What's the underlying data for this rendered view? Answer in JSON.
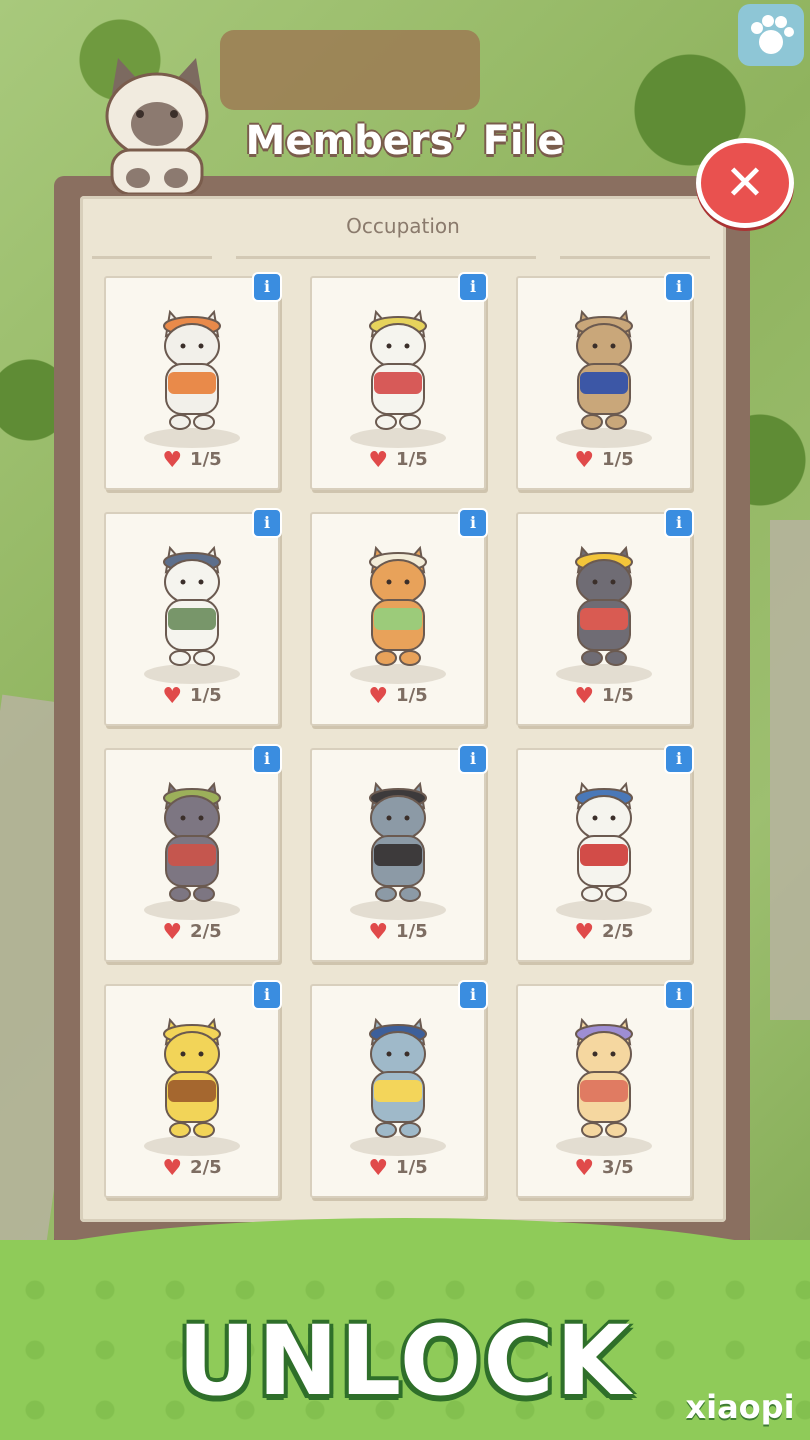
{
  "header": {
    "title": "Members’ File"
  },
  "section": {
    "label": "Occupation"
  },
  "cards": [
    {
      "count": "1/5",
      "cat": "cat-carrying-towels",
      "body": "#f2f0ea",
      "accent": "#e98a4a",
      "hat": "#e98a4a"
    },
    {
      "count": "1/5",
      "cat": "cat-gardener-watering-can",
      "body": "#f5f4ee",
      "accent": "#d75a58",
      "hat": "#e6d35c"
    },
    {
      "count": "1/5",
      "cat": "cat-basketball-player",
      "body": "#c9a77a",
      "accent": "#3c57a6",
      "hat": "#c9a77a"
    },
    {
      "count": "1/5",
      "cat": "cat-painter-palette",
      "body": "#f5f4ee",
      "accent": "#78966a",
      "hat": "#5d6f8c"
    },
    {
      "count": "1/5",
      "cat": "cat-fisher-with-bucket",
      "body": "#e8a25a",
      "accent": "#9ccb7a",
      "hat": "#f3ecd8"
    },
    {
      "count": "1/5",
      "cat": "cat-construction-worker",
      "body": "#6f6c74",
      "accent": "#d95b52",
      "hat": "#f2c53a"
    },
    {
      "count": "2/5",
      "cat": "cat-roman-orator",
      "body": "#7d7682",
      "accent": "#c5564e",
      "hat": "#9cb05a"
    },
    {
      "count": "1/5",
      "cat": "cat-gentleman-suit",
      "body": "#8c9aa6",
      "accent": "#3d3a3b",
      "hat": "#3d3a3b"
    },
    {
      "count": "2/5",
      "cat": "cat-rapper-striped-shirt",
      "body": "#f5f4ee",
      "accent": "#d24c48",
      "hat": "#4a78b8"
    },
    {
      "count": "2/5",
      "cat": "cat-bee-costume-honey",
      "body": "#f2d458",
      "accent": "#a5672f",
      "hat": "#f2d458"
    },
    {
      "count": "1/5",
      "cat": "cat-swimmer-duck-ring",
      "body": "#9fb9c9",
      "accent": "#f3d55a",
      "hat": "#3d5f9a"
    },
    {
      "count": "3/5",
      "cat": "cat-bucket-hat-watermelon",
      "body": "#f5d7a0",
      "accent": "#e07b62",
      "hat": "#9e8ed3"
    }
  ],
  "bottom": {
    "banner": "UNLOCK"
  },
  "watermark": {
    "text": "xiaopi"
  }
}
